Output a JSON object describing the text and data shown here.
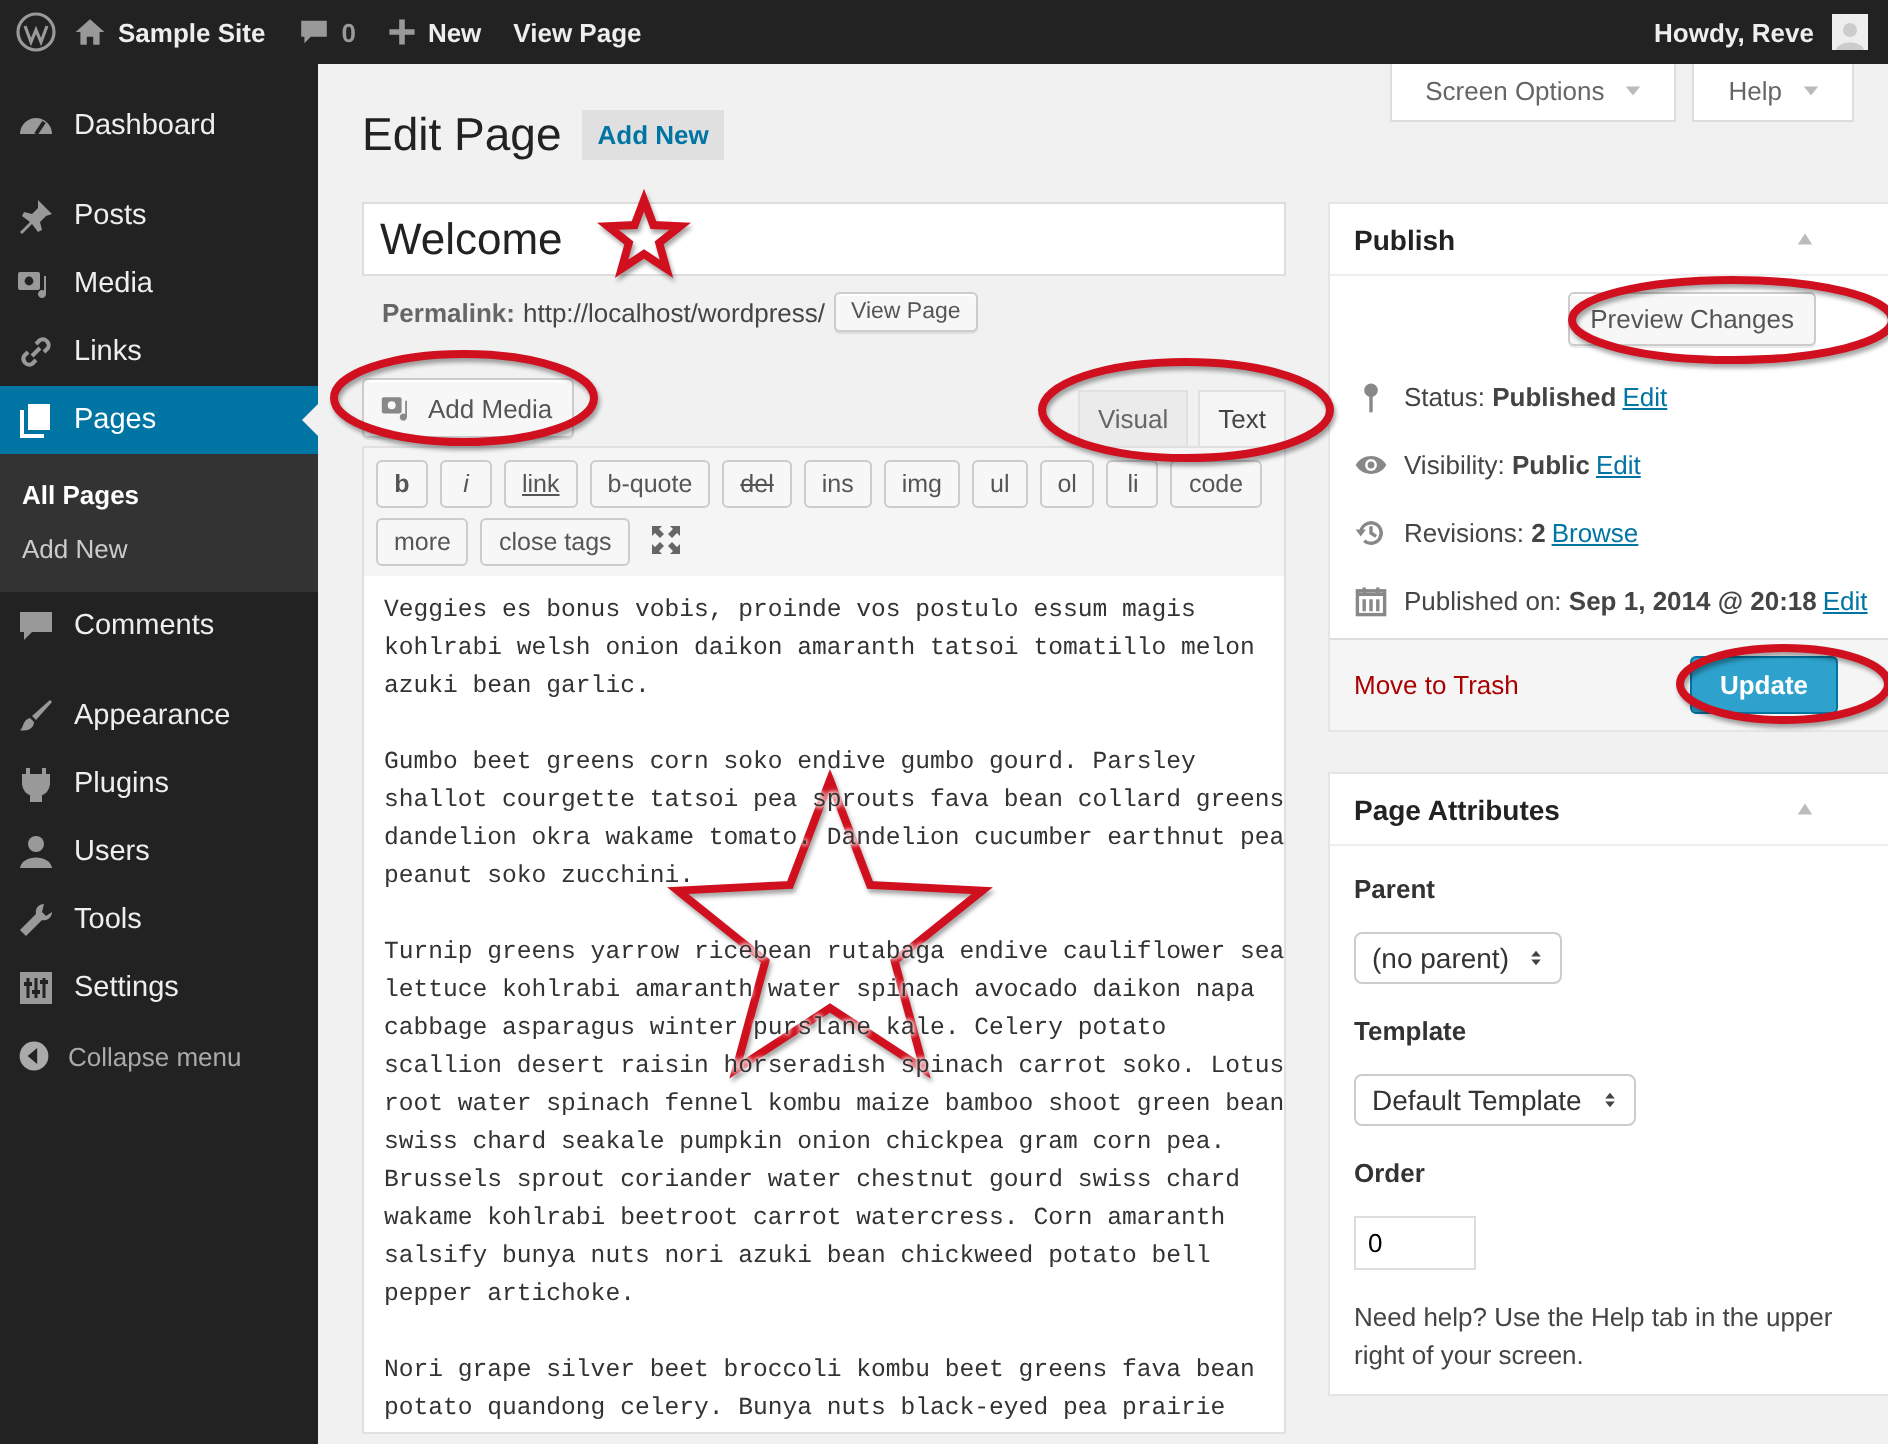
{
  "admin_bar": {
    "site": "Sample Site",
    "comments": "0",
    "new": "New",
    "view": "View Page",
    "greeting": "Howdy, Reve"
  },
  "sidebar": {
    "groups": [
      [
        {
          "label": "Dashboard",
          "selected": false
        }
      ],
      [
        {
          "label": "Posts",
          "selected": false
        },
        {
          "label": "Media",
          "selected": false
        },
        {
          "label": "Links",
          "selected": false
        },
        {
          "label": "Pages",
          "selected": true,
          "children": [
            {
              "label": "All Pages",
              "selected": true
            },
            {
              "label": "Add New",
              "selected": false
            }
          ]
        },
        {
          "label": "Comments",
          "selected": false
        }
      ],
      [
        {
          "label": "Appearance",
          "selected": false
        },
        {
          "label": "Plugins",
          "selected": false
        },
        {
          "label": "Users",
          "selected": false
        },
        {
          "label": "Tools",
          "selected": false
        },
        {
          "label": "Settings",
          "selected": false
        }
      ]
    ],
    "collapse": "Collapse menu"
  },
  "screen_tabs": [
    "Screen Options",
    "Help"
  ],
  "heading": {
    "title": "Edit Page",
    "add_new": "Add New"
  },
  "title_field": {
    "value": "Welcome"
  },
  "permalink": {
    "label": "Permalink:",
    "url": "http://localhost/wordpress/",
    "button": "View Page"
  },
  "add_media": "Add Media",
  "editor_tabs": [
    {
      "label": "Visual",
      "selected": false
    },
    {
      "label": "Text",
      "selected": true
    }
  ],
  "quicktags": [
    {
      "label": "b",
      "kind": "bold"
    },
    {
      "label": "i",
      "kind": "italic"
    },
    {
      "label": "link",
      "kind": "underline"
    },
    {
      "label": "b-quote",
      "kind": "plain"
    },
    {
      "label": "del",
      "kind": "strike"
    },
    {
      "label": "ins",
      "kind": "plain"
    },
    {
      "label": "img",
      "kind": "plain"
    },
    {
      "label": "ul",
      "kind": "plain"
    },
    {
      "label": "ol",
      "kind": "plain"
    },
    {
      "label": "li",
      "kind": "plain"
    },
    {
      "label": "code",
      "kind": "plain"
    },
    {
      "label": "more",
      "kind": "plain"
    },
    {
      "label": "close tags",
      "kind": "plain"
    }
  ],
  "content": "Veggies es bonus vobis, proinde vos postulo essum magis\nkohlrabi welsh onion daikon amaranth tatsoi tomatillo melon\nazuki bean garlic.\n\nGumbo beet greens corn soko endive gumbo gourd. Parsley\nshallot courgette tatsoi pea sprouts fava bean collard greens\ndandelion okra wakame tomato. Dandelion cucumber earthnut pea\npeanut soko zucchini.\n\nTurnip greens yarrow ricebean rutabaga endive cauliflower sea\nlettuce kohlrabi amaranth water spinach avocado daikon napa\ncabbage asparagus winter purslane kale. Celery potato\nscallion desert raisin horseradish spinach carrot soko. Lotus\nroot water spinach fennel kombu maize bamboo shoot green bean\nswiss chard seakale pumpkin onion chickpea gram corn pea.\nBrussels sprout coriander water chestnut gourd swiss chard\nwakame kohlrabi beetroot carrot watercress. Corn amaranth\nsalsify bunya nuts nori azuki bean chickweed potato bell\npepper artichoke.\n\nNori grape silver beet broccoli kombu beet greens fava bean\npotato quandong celery. Bunya nuts black-eyed pea prairie",
  "publish": {
    "title": "Publish",
    "preview": "Preview Changes",
    "rows": [
      {
        "label": "Status:",
        "value": "Published",
        "link": "Edit"
      },
      {
        "label": "Visibility:",
        "value": "Public",
        "link": "Edit"
      },
      {
        "label": "Revisions:",
        "value": "2",
        "link": "Browse"
      },
      {
        "label": "Published on:",
        "value": "Sep 1, 2014 @ 20:18",
        "link": "Edit"
      }
    ],
    "trash": "Move to Trash",
    "update": "Update"
  },
  "attributes": {
    "title": "Page Attributes",
    "fields": [
      {
        "label": "Parent",
        "kind": "select",
        "value": "(no parent)"
      },
      {
        "label": "Template",
        "kind": "select",
        "value": "Default Template"
      },
      {
        "label": "Order",
        "kind": "input",
        "value": "0"
      }
    ],
    "help": "Need help? Use the Help tab in the upper right of your screen."
  }
}
